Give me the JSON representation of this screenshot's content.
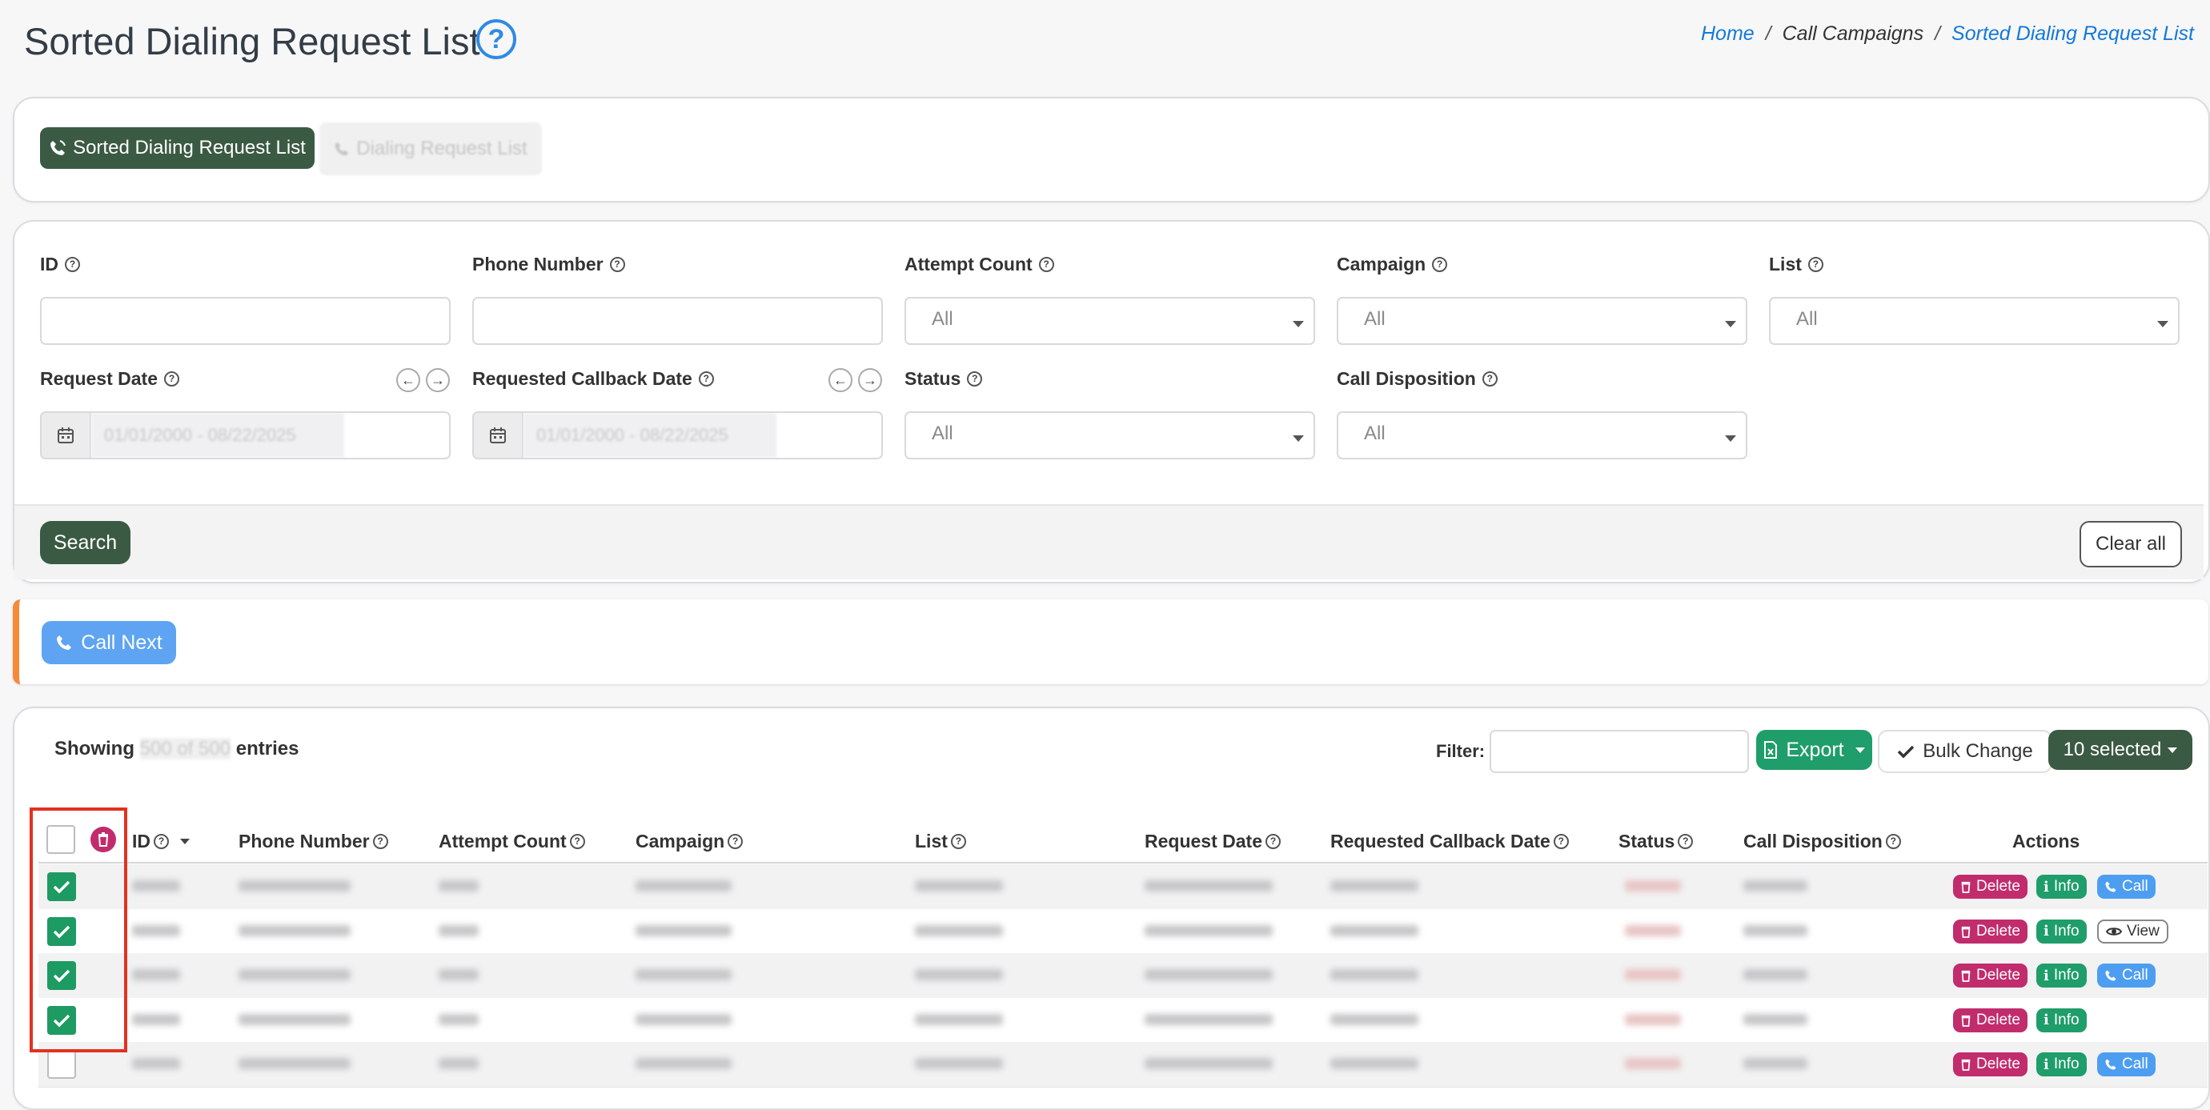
{
  "page": {
    "title": "Sorted Dialing Request List",
    "help_glyph": "?"
  },
  "breadcrumb": {
    "home": "Home",
    "sep1": "/",
    "middle": "Call Campaigns",
    "sep2": "/",
    "current": "Sorted Dialing Request List"
  },
  "tabs": {
    "active": "Sorted Dialing Request List",
    "inactive": "Dialing Request List"
  },
  "filters": {
    "id_label": "ID",
    "phone_label": "Phone Number",
    "attempt_label": "Attempt Count",
    "attempt_value": "All",
    "campaign_label": "Campaign",
    "campaign_value": "All",
    "list_label": "List",
    "list_value": "All",
    "request_date_label": "Request Date",
    "request_date_value": "01/01/2000 - 08/22/2025",
    "callback_date_label": "Requested Callback Date",
    "callback_date_value": "01/01/2000 - 08/22/2025",
    "status_label": "Status",
    "status_value": "All",
    "disposition_label": "Call Disposition",
    "disposition_value": "All",
    "prev_glyph": "←",
    "next_glyph": "→",
    "help_glyph": "?"
  },
  "search_bar": {
    "search_label": "Search",
    "clear_label": "Clear all"
  },
  "call_next": {
    "label": "Call Next"
  },
  "table_toolbar": {
    "showing_prefix": "Showing",
    "showing_count": "500 of 500",
    "showing_suffix": "entries",
    "filter_label": "Filter:",
    "filter_value": "",
    "export_label": "Export",
    "bulk_change_label": "Bulk Change",
    "selected_label": "10 selected"
  },
  "table": {
    "headers": {
      "id": "ID",
      "phone": "Phone Number",
      "attempt": "Attempt Count",
      "campaign": "Campaign",
      "list": "List",
      "request_date": "Request Date",
      "callback_date": "Requested Callback Date",
      "status": "Status",
      "disposition": "Call Disposition",
      "actions": "Actions"
    },
    "action_labels": {
      "delete": "Delete",
      "info": "Info",
      "call": "Call",
      "view": "View"
    },
    "rows": [
      {
        "checked": true,
        "actions": [
          "delete",
          "info",
          "call"
        ]
      },
      {
        "checked": true,
        "actions": [
          "delete",
          "info",
          "view"
        ]
      },
      {
        "checked": true,
        "actions": [
          "delete",
          "info",
          "call"
        ]
      },
      {
        "checked": true,
        "actions": [
          "delete",
          "info"
        ]
      },
      {
        "checked": false,
        "actions": [
          "delete",
          "info",
          "call"
        ]
      }
    ]
  },
  "colors": {
    "dark_green": "#3b5a43",
    "green": "#1f9d6a",
    "blue": "#5ea4f2",
    "magenta": "#c12c6c",
    "orange_accent": "#f58b3a",
    "highlight_red": "#e2321f",
    "link_blue": "#1479d8"
  }
}
